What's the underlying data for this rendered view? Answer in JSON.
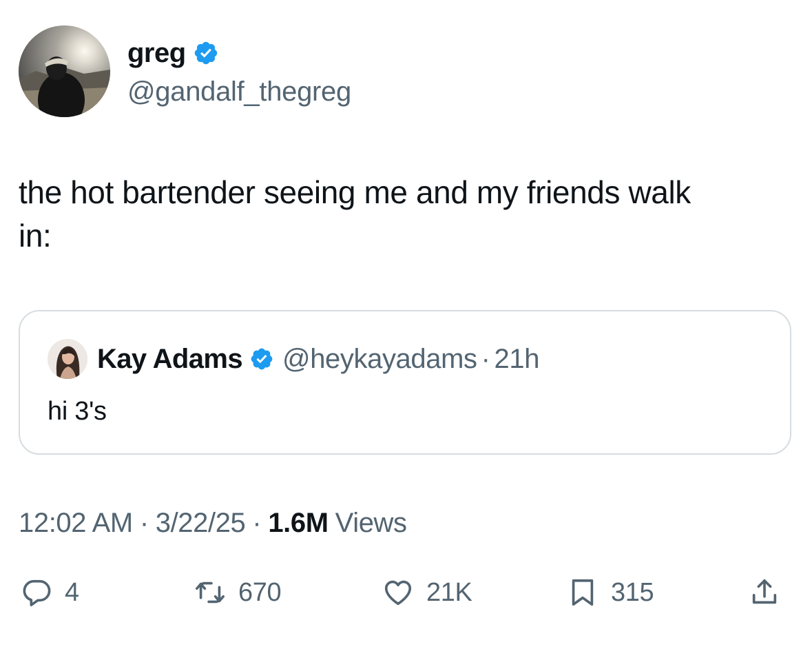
{
  "author": {
    "name": "greg",
    "handle": "@gandalf_thegreg",
    "verified": true
  },
  "tweet": {
    "text": "the hot bartender seeing me and my friends walk\nin:"
  },
  "quoted_tweet": {
    "name": "Kay Adams",
    "handle": "@heykayadams",
    "separator": "·",
    "time_ago": "21h",
    "verified": true,
    "text": "hi 3's"
  },
  "meta": {
    "time": "12:02 AM",
    "separator": "·",
    "date": "3/22/25",
    "views_count": "1.6M",
    "views_label": "Views"
  },
  "actions": {
    "replies": "4",
    "reposts": "670",
    "likes": "21K",
    "bookmarks": "315"
  },
  "colors": {
    "text_primary": "#0f1419",
    "text_secondary": "#536471",
    "verified_blue": "#1d9bf0",
    "border": "#d6dce0"
  },
  "icons": {
    "verified": "verified-badge-icon",
    "reply": "reply-bubble-icon",
    "repost": "repost-arrows-icon",
    "like": "heart-icon",
    "bookmark": "bookmark-icon",
    "share": "share-upload-icon"
  }
}
